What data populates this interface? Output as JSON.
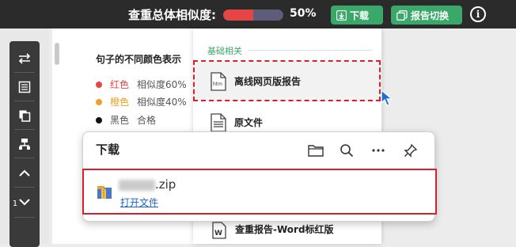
{
  "topbar": {
    "similarity_label": "查重总体相似度:",
    "similarity_value": 0.5,
    "similarity_percent": "50%",
    "download_label": "下载",
    "switch_label": "报告切换",
    "info_glyph": "i",
    "colors": {
      "bar_bg": "#2b2b2b",
      "button": "#3aa869",
      "progress_fill": "#e64545",
      "progress_track": "#5d5d7a"
    }
  },
  "sidebar": {
    "tools": [
      {
        "icon": "swap-arrows-icon"
      },
      {
        "icon": "list-icon"
      },
      {
        "icon": "copy-icon"
      },
      {
        "icon": "structure-icon"
      },
      {
        "icon": "chevron-up-icon"
      },
      {
        "icon": "chevron-down-icon"
      }
    ],
    "page_number": "1"
  },
  "document": {
    "title": "句子的不同颜色表示",
    "legend": [
      {
        "color_name": "红色",
        "desc": "相似度60%",
        "dot": "#e64545"
      },
      {
        "color_name": "橙色",
        "desc": "相似度40%",
        "dot": "#f0a020"
      },
      {
        "color_name": "黑色",
        "desc": "合格",
        "dot": "#111111"
      }
    ]
  },
  "menu": {
    "section_label": "基础相关",
    "items": [
      {
        "label": "离线网页版报告",
        "icon": "html-file-icon"
      },
      {
        "label": "原文件",
        "icon": "document-icon"
      },
      {
        "label": "查重报告-Word标红版",
        "icon": "word-file-icon"
      }
    ],
    "html_icon_text": "htm",
    "word_icon_text": "W"
  },
  "download_panel": {
    "title": "下载",
    "file_ext": ".zip",
    "open_file_label": "打开文件"
  }
}
